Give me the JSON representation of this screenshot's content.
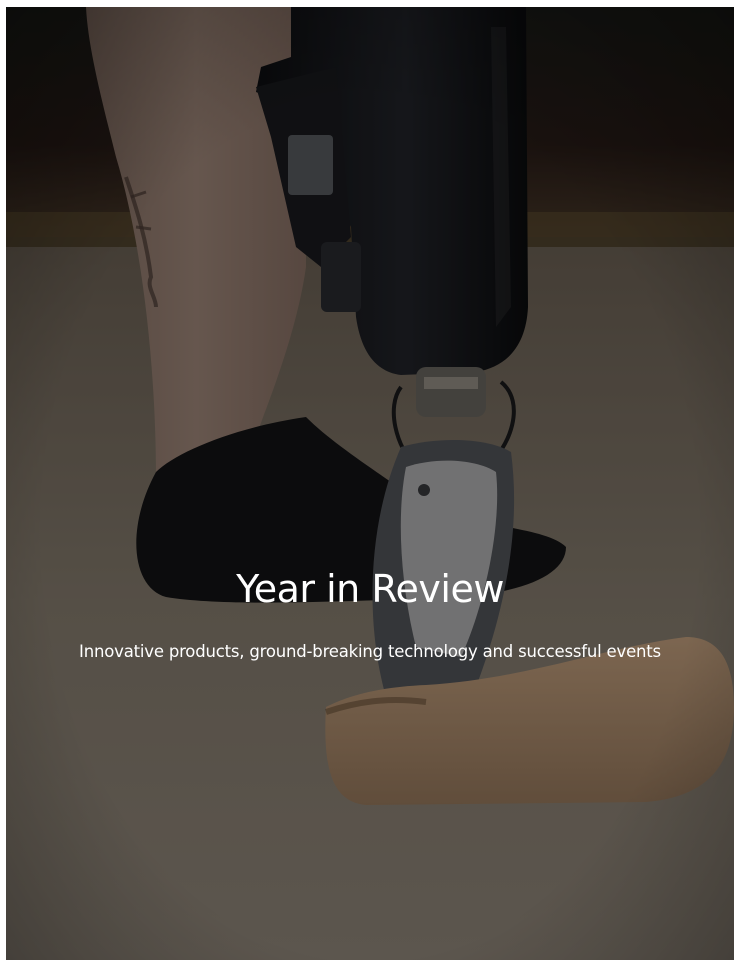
{
  "hero": {
    "image": "prosthetic-leg-photo",
    "title": "Year in Review",
    "subtitle": "Innovative products, ground-breaking technology and successful events"
  }
}
